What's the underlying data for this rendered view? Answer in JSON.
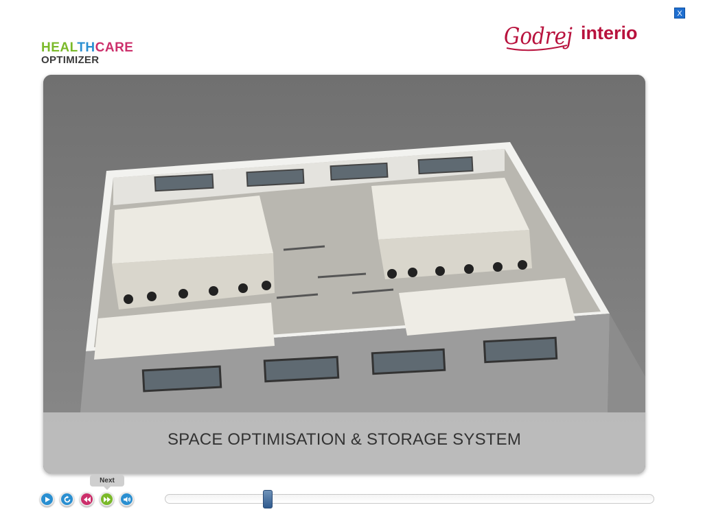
{
  "window": {
    "close_label": "X"
  },
  "brand": {
    "health": "HEAL",
    "th": "TH",
    "care": "CARE",
    "subtitle": "OPTIMIZER"
  },
  "partner_logo": {
    "script": "Godrej",
    "word": "interio"
  },
  "stage": {
    "caption": "SPACE OPTIMISATION & STORAGE SYSTEM"
  },
  "controls": {
    "tooltip": "Next",
    "buttons": [
      {
        "name": "play",
        "color": "#2a8fd1"
      },
      {
        "name": "replay",
        "color": "#2a8fd1"
      },
      {
        "name": "previous",
        "color": "#cc2f6b"
      },
      {
        "name": "next",
        "color": "#7ab929"
      },
      {
        "name": "volume",
        "color": "#2a8fd1"
      }
    ],
    "progress": 0.2
  }
}
